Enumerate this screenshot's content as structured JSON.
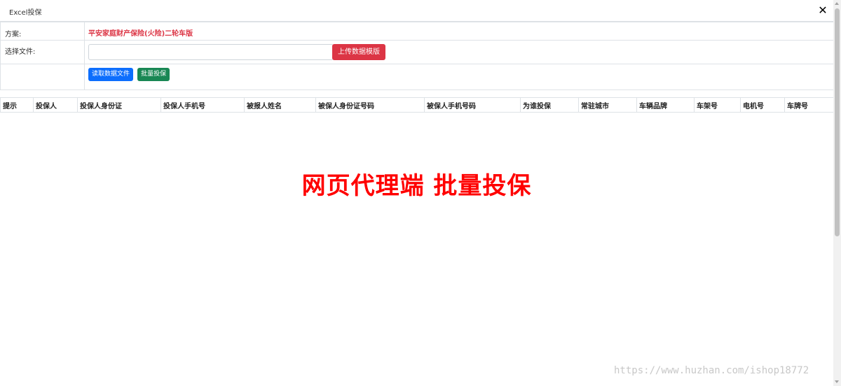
{
  "modal": {
    "title": "Excel投保",
    "close_glyph": "✕"
  },
  "form": {
    "plan_label": "方案:",
    "plan_value": "平安家庭财产保险(火险)二轮车版",
    "file_label": "选择文件:",
    "file_value": "",
    "upload_button": "上传数据模版",
    "read_button": "读取数据文件",
    "batch_button": "批量投保"
  },
  "grid": {
    "columns": [
      "提示",
      "投保人",
      "投保人身份证",
      "投保人手机号",
      "被报人姓名",
      "被保人身份证号码",
      "被保人手机号码",
      "为谁投保",
      "常驻城市",
      "车辆品牌",
      "车架号",
      "电机号",
      "车牌号"
    ]
  },
  "banner": {
    "text": "网页代理端 批量投保"
  },
  "watermark": {
    "text": "https://www.huzhan.com/ishop18772"
  },
  "colors": {
    "danger": "#dc3545",
    "primary": "#0d6efd",
    "success": "#198754",
    "banner": "#ff0000"
  }
}
